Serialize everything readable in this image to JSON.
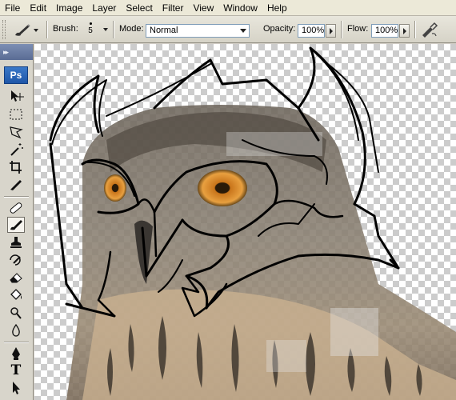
{
  "menubar": {
    "items": [
      "File",
      "Edit",
      "Image",
      "Layer",
      "Select",
      "Filter",
      "View",
      "Window",
      "Help"
    ]
  },
  "options": {
    "brush_label": "Brush:",
    "brush_size": "5",
    "mode_label": "Mode:",
    "mode_value": "Normal",
    "opacity_label": "Opacity:",
    "opacity_value": "100%",
    "flow_label": "Flow:",
    "flow_value": "100%"
  },
  "palette": {
    "logo": "Ps",
    "text_tool_glyph": "T"
  },
  "colors": {
    "accent": "#1e56a8",
    "menubar": "#ece9d8",
    "panel": "#d8d5cb"
  }
}
